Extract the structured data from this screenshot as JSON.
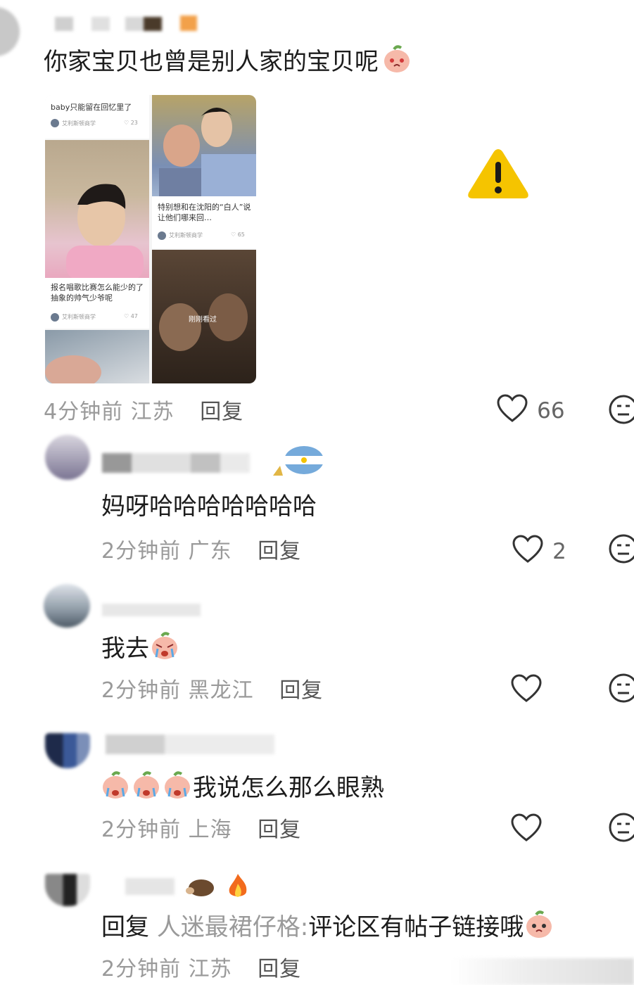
{
  "post": {
    "text": "你家宝贝也曾是别人家的宝贝呢",
    "time": "4分钟前",
    "location": "江苏",
    "reply_label": "回复",
    "likes": "66"
  },
  "grid": {
    "cell1_caption_lines": [
      "baby只能留在回忆里了"
    ],
    "cell1_author": "艾利斯顿商学",
    "cell1_likes": "23",
    "cell2_caption": "特别想和在沈阳的“白人”说让他们哪来回…",
    "cell2_author": "艾利斯顿商学",
    "cell2_likes": "65",
    "cell3_caption": "报名唱歌比赛怎么能少的了抽象的帅气少爷呢",
    "cell3_author": "艾利斯顿商学",
    "cell3_likes": "47",
    "cell4_overlay": "刚刚看过"
  },
  "comments": [
    {
      "text": "妈呀哈哈哈哈哈哈哈",
      "time": "2分钟前",
      "location": "广东",
      "reply_label": "回复",
      "likes": "2"
    },
    {
      "text": "我去",
      "time": "2分钟前",
      "location": "黑龙江",
      "reply_label": "回复",
      "likes": ""
    },
    {
      "text": "我说怎么那么眼熟",
      "time": "2分钟前",
      "location": "上海",
      "reply_label": "回复",
      "likes": ""
    },
    {
      "reply_prefix": "回复",
      "reply_to": "人迷最裙仔格:",
      "text": "评论区有帖子链接哦",
      "time": "2分钟前",
      "location": "江苏",
      "reply_label": "回复"
    }
  ],
  "colors": {
    "warning": "#f5c400",
    "meta": "#9a9a9a",
    "accent_flag": "#75aadb"
  }
}
